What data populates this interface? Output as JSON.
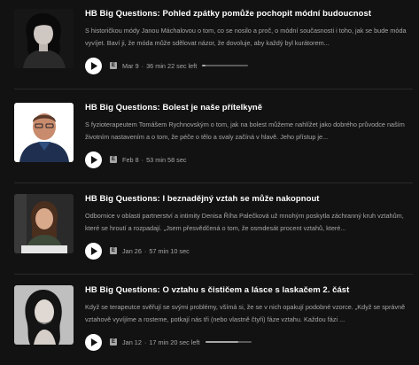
{
  "episodes": [
    {
      "title": "HB Big Questions: Pohled zpátky pomůže pochopit módní budoucnost",
      "description": "S historičkou módy Janou Máchalovou o tom, co se nosilo a proč, o módní současnosti i toho, jak se bude móda vyvíjet.  Baví ji, že móda může sdělovat názor, že dovoluje, aby každý byl kurátorem...",
      "date": "Mar 9",
      "time_info": "36 min 22 sec left",
      "has_progress": true,
      "progress": 0.08,
      "badge": "E"
    },
    {
      "title": "HB Big Questions: Bolest je naše přítelkyně",
      "description": "S fyzioterapeutem Tomášem Rychnovským o tom, jak na bolest můžeme nahlížet jako dobrého průvodce naším životním nastavením a o tom, že péče o tělo a svaly začíná v hlavě.  Jeho přístup je...",
      "date": "Feb 8",
      "time_info": "53 min 58 sec",
      "has_progress": false,
      "progress": 0,
      "badge": "E"
    },
    {
      "title": "HB Big Questions: I beznadějný vztah se může nakopnout",
      "description": "Odbornice v oblasti partnerství a intimity Denisa Říha Palečková už mnohým poskytla záchranný kruh vztahům, které se hroutí a rozpadají. „Jsem přesvědčená o tom, že osmdesát procent vztahů, které...",
      "date": "Jan 26",
      "time_info": "57 min 10 sec",
      "has_progress": false,
      "progress": 0,
      "badge": "E"
    },
    {
      "title": "HB Big Questions: O vztahu s čističem a lásce s laskačem 2. část",
      "description": "Když se terapeutce svěřují se svými problémy, všímá si, že se v nich opakují podobné vzorce. „Když se správně vztahově vyvíjíme a rosteme, potkají nás tři (nebo vlastně čtyři) fáze vztahu. Každou fázi ...",
      "date": "Jan 12",
      "time_info": "17 min 20 sec left",
      "has_progress": true,
      "progress": 0.72,
      "badge": "E"
    }
  ],
  "icons": {
    "play": "play-icon",
    "explicit": "explicit-badge-icon"
  },
  "colors": {
    "background": "#121212",
    "text_primary": "#ffffff",
    "text_secondary": "#a7a7a7"
  }
}
